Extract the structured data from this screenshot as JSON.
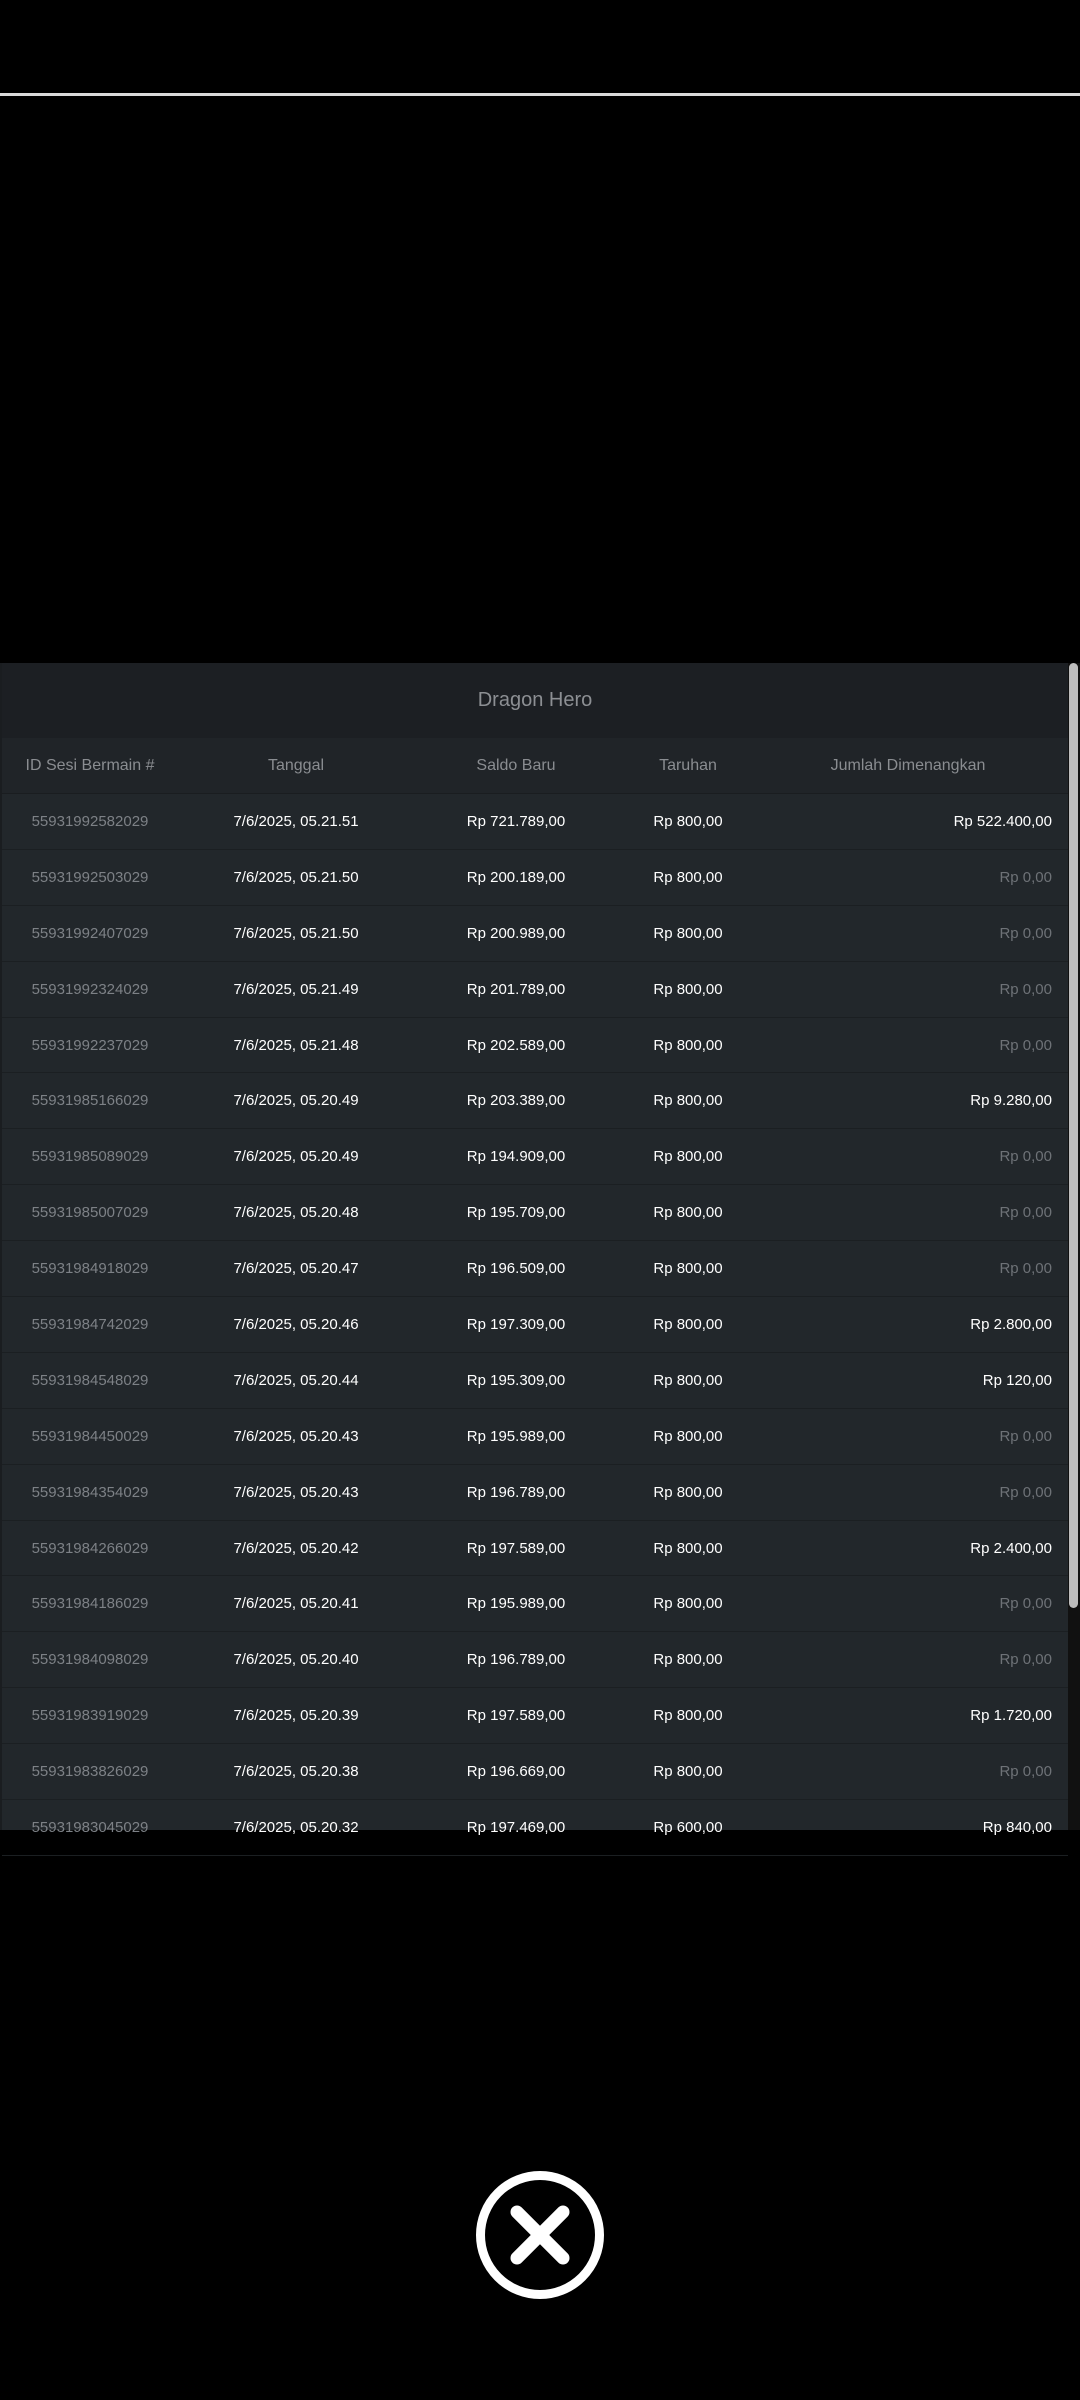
{
  "game": {
    "title": "Dragon Hero"
  },
  "table": {
    "headers": [
      "ID Sesi Bermain #",
      "Tanggal",
      "Saldo Baru",
      "Taruhan",
      "Jumlah Dimenangkan"
    ],
    "rows": [
      [
        "55931992582029",
        "7/6/2025, 05.21.51",
        "Rp 721.789,00",
        "Rp 800,00",
        "Rp 522.400,00"
      ],
      [
        "55931992503029",
        "7/6/2025, 05.21.50",
        "Rp 200.189,00",
        "Rp 800,00",
        "Rp 0,00"
      ],
      [
        "55931992407029",
        "7/6/2025, 05.21.50",
        "Rp 200.989,00",
        "Rp 800,00",
        "Rp 0,00"
      ],
      [
        "55931992324029",
        "7/6/2025, 05.21.49",
        "Rp 201.789,00",
        "Rp 800,00",
        "Rp 0,00"
      ],
      [
        "55931992237029",
        "7/6/2025, 05.21.48",
        "Rp 202.589,00",
        "Rp 800,00",
        "Rp 0,00"
      ],
      [
        "55931985166029",
        "7/6/2025, 05.20.49",
        "Rp 203.389,00",
        "Rp 800,00",
        "Rp 9.280,00"
      ],
      [
        "55931985089029",
        "7/6/2025, 05.20.49",
        "Rp 194.909,00",
        "Rp 800,00",
        "Rp 0,00"
      ],
      [
        "55931985007029",
        "7/6/2025, 05.20.48",
        "Rp 195.709,00",
        "Rp 800,00",
        "Rp 0,00"
      ],
      [
        "55931984918029",
        "7/6/2025, 05.20.47",
        "Rp 196.509,00",
        "Rp 800,00",
        "Rp 0,00"
      ],
      [
        "55931984742029",
        "7/6/2025, 05.20.46",
        "Rp 197.309,00",
        "Rp 800,00",
        "Rp 2.800,00"
      ],
      [
        "55931984548029",
        "7/6/2025, 05.20.44",
        "Rp 195.309,00",
        "Rp 800,00",
        "Rp 120,00"
      ],
      [
        "55931984450029",
        "7/6/2025, 05.20.43",
        "Rp 195.989,00",
        "Rp 800,00",
        "Rp 0,00"
      ],
      [
        "55931984354029",
        "7/6/2025, 05.20.43",
        "Rp 196.789,00",
        "Rp 800,00",
        "Rp 0,00"
      ],
      [
        "55931984266029",
        "7/6/2025, 05.20.42",
        "Rp 197.589,00",
        "Rp 800,00",
        "Rp 2.400,00"
      ],
      [
        "55931984186029",
        "7/6/2025, 05.20.41",
        "Rp 195.989,00",
        "Rp 800,00",
        "Rp 0,00"
      ],
      [
        "55931984098029",
        "7/6/2025, 05.20.40",
        "Rp 196.789,00",
        "Rp 800,00",
        "Rp 0,00"
      ],
      [
        "55931983919029",
        "7/6/2025, 05.20.39",
        "Rp 197.589,00",
        "Rp 800,00",
        "Rp 1.720,00"
      ],
      [
        "55931983826029",
        "7/6/2025, 05.20.38",
        "Rp 196.669,00",
        "Rp 800,00",
        "Rp 0,00"
      ],
      [
        "55931983045029",
        "7/6/2025, 05.20.32",
        "Rp 197.469,00",
        "Rp 600,00",
        "Rp 840,00"
      ]
    ]
  },
  "close_button": {
    "icon": "close-icon"
  },
  "colors": {
    "background": "#000000",
    "panel": "#22272b",
    "text_primary": "#ffffff",
    "text_muted": "#7d8186"
  }
}
